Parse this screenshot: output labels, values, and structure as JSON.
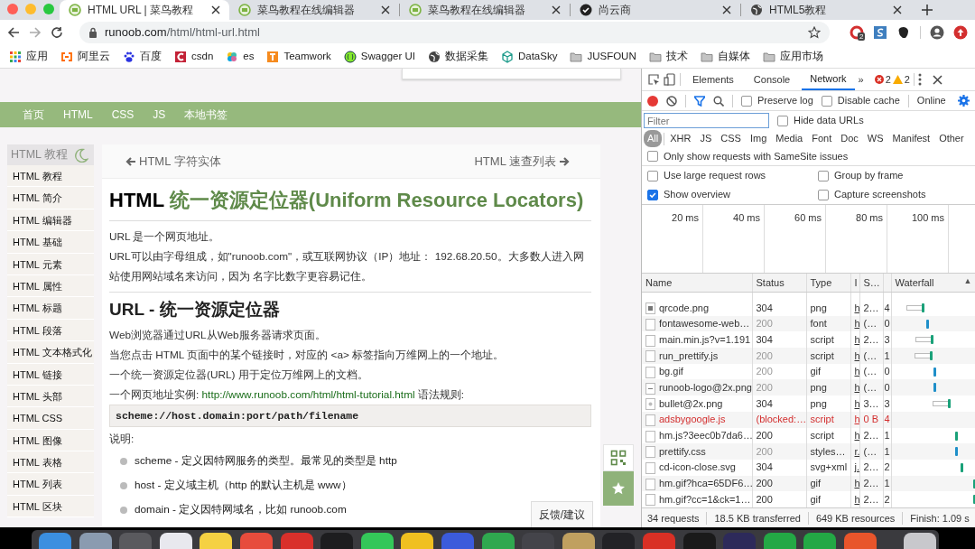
{
  "browser": {
    "tabs": [
      {
        "title": "HTML URL | 菜鸟教程",
        "selected": true
      },
      {
        "title": "菜鸟教程在线编辑器",
        "selected": false
      },
      {
        "title": "菜鸟教程在线编辑器",
        "selected": false
      },
      {
        "title": "尚云商",
        "selected": false
      },
      {
        "title": "HTML5教程",
        "selected": false
      }
    ],
    "address": {
      "host": "runoob.com",
      "path": "/html/html-url.html"
    },
    "extension_badge": "2",
    "bookmarks": [
      "应用",
      "阿里云",
      "百度",
      "csdn",
      "es",
      "Teamwork",
      "Swagger UI",
      "数据采集",
      "DataSky",
      "JUSFOUN",
      "技术",
      "自媒体",
      "应用市场"
    ]
  },
  "page": {
    "nav": [
      "首页",
      "HTML",
      "CSS",
      "JS",
      "本地书签"
    ],
    "sidebar": {
      "title": "HTML 教程",
      "items": [
        "HTML 教程",
        "HTML 简介",
        "HTML 编辑器",
        "HTML 基础",
        "HTML 元素",
        "HTML 属性",
        "HTML 标题",
        "HTML 段落",
        "HTML 文本格式化",
        "HTML 链接",
        "HTML 头部",
        "HTML CSS",
        "HTML 图像",
        "HTML 表格",
        "HTML 列表",
        "HTML 区块"
      ]
    },
    "pager": {
      "prev": "HTML 字符实体",
      "next": "HTML 速查列表"
    },
    "article": [
      {
        "kind": "h1",
        "lead": "HTML",
        "text": "统一资源定位器(Uniform Resource Locators)"
      },
      {
        "kind": "rule"
      },
      {
        "kind": "p",
        "text": "URL 是一个网页地址。"
      },
      {
        "kind": "p",
        "text": "URL可以由字母组成，如\"runoob.com\"，或互联网协议（IP）地址： 192.68.20.50。大多数人进入网站使用网站域名来访问，因为 名字比数字更容易记住。"
      },
      {
        "kind": "rule"
      },
      {
        "kind": "h2",
        "text": "URL - 统一资源定位器"
      },
      {
        "kind": "p",
        "text": "Web浏览器通过URL从Web服务器请求页面。"
      },
      {
        "kind": "p",
        "text": "当您点击 HTML 页面中的某个链接时，对应的 <a> 标签指向万维网上的一个地址。"
      },
      {
        "kind": "p",
        "text": "一个统一资源定位器(URL) 用于定位万维网上的文档。"
      },
      {
        "kind": "link_p",
        "before": "一个网页地址实例: ",
        "link": "http://www.runoob.com/html/html-tutorial.html",
        "after": " 语法规则:"
      },
      {
        "kind": "code",
        "text": "scheme://host.domain:port/path/filename"
      },
      {
        "kind": "p",
        "text": "说明:"
      },
      {
        "kind": "bullet",
        "text": "scheme - 定义因特网服务的类型。最常见的类型是 http"
      },
      {
        "kind": "bullet",
        "text": "host - 定义域主机（http 的默认主机是 www）"
      },
      {
        "kind": "bullet",
        "text": "domain - 定义因特网域名，比如 runoob.com"
      }
    ],
    "feedback": "反馈/建议"
  },
  "devtools": {
    "tabs": [
      {
        "label": "Elements",
        "selected": false
      },
      {
        "label": "Console",
        "selected": false
      },
      {
        "label": "Network",
        "selected": true
      }
    ],
    "more": "»",
    "errors": "2",
    "warnings": "2",
    "toolbar_checks": [
      {
        "label": "Preserve log",
        "checked": false
      },
      {
        "label": "Disable cache",
        "checked": false
      }
    ],
    "throttle": "Online",
    "filter": {
      "placeholder": "Filter"
    },
    "hide_data": {
      "label": "Hide data URLs",
      "checked": false
    },
    "types": [
      {
        "label": "All",
        "selected": true
      },
      {
        "label": "XHR",
        "selected": false
      },
      {
        "label": "JS",
        "selected": false
      },
      {
        "label": "CSS",
        "selected": false
      },
      {
        "label": "Img",
        "selected": false
      },
      {
        "label": "Media",
        "selected": false
      },
      {
        "label": "Font",
        "selected": false
      },
      {
        "label": "Doc",
        "selected": false
      },
      {
        "label": "WS",
        "selected": false
      },
      {
        "label": "Manifest",
        "selected": false
      },
      {
        "label": "Other",
        "selected": false
      }
    ],
    "samesite": {
      "label": "Only show requests with SameSite issues",
      "checked": false
    },
    "options": [
      {
        "label": "Use large request rows",
        "checked": false
      },
      {
        "label": "Group by frame",
        "checked": false
      },
      {
        "label": "Show overview",
        "checked": true
      },
      {
        "label": "Capture screenshots",
        "checked": false
      }
    ],
    "overview_ticks": [
      "20 ms",
      "40 ms",
      "60 ms",
      "80 ms",
      "100 ms"
    ],
    "columns": [
      "Name",
      "Status",
      "Type",
      "I",
      "S…",
      "Waterfall"
    ],
    "sort_glyph": "▲",
    "rows": [
      {
        "name": "qrcode.png",
        "status": "304",
        "type": "png",
        "initiator": "h",
        "size": "2…",
        "time": "4",
        "cached": false,
        "failed": false,
        "level": 0.37,
        "queued": true,
        "color": "#1aa179"
      },
      {
        "name": "fontawesome-web…",
        "status": "200",
        "type": "font",
        "initiator": "h",
        "size": "(…",
        "time": "0",
        "cached": true,
        "failed": false,
        "level": 0.42,
        "queued": false,
        "color": "#1f8fc9"
      },
      {
        "name": "main.min.js?v=1.191",
        "status": "304",
        "type": "script",
        "initiator": "h",
        "size": "2…",
        "time": "3",
        "cached": false,
        "failed": false,
        "level": 0.48,
        "queued": true,
        "color": "#1aa179"
      },
      {
        "name": "run_prettify.js",
        "status": "200",
        "type": "script",
        "initiator": "h",
        "size": "(…",
        "time": "1",
        "cached": true,
        "failed": false,
        "level": 0.47,
        "queued": true,
        "color": "#1aa179"
      },
      {
        "name": "bg.gif",
        "status": "200",
        "type": "gif",
        "initiator": "h",
        "size": "(…",
        "time": "0",
        "cached": true,
        "failed": false,
        "level": 0.51,
        "queued": false,
        "color": "#1f8fc9"
      },
      {
        "name": "runoob-logo@2x.png",
        "status": "200",
        "type": "png",
        "initiator": "h",
        "size": "(…",
        "time": "0",
        "cached": true,
        "failed": false,
        "level": 0.51,
        "queued": false,
        "color": "#1f8fc9"
      },
      {
        "name": "bullet@2x.png",
        "status": "304",
        "type": "png",
        "initiator": "h",
        "size": "3…",
        "time": "3",
        "cached": false,
        "failed": false,
        "level": 0.68,
        "queued": true,
        "color": "#1aa179"
      },
      {
        "name": "adsbygoogle.js",
        "status": "(blocked:…",
        "type": "script",
        "initiator": "h",
        "size": "0 B",
        "time": "4",
        "failed": true
      },
      {
        "name": "hm.js?3eec0b7da6…",
        "status": "200",
        "type": "script",
        "initiator": "h",
        "size": "2…",
        "time": "1",
        "cached": false,
        "failed": false,
        "level": 0.77,
        "queued": false,
        "color": "#1aa179"
      },
      {
        "name": "prettify.css",
        "status": "200",
        "type": "styles…",
        "initiator": "r.",
        "size": "(…",
        "time": "1",
        "cached": true,
        "failed": false,
        "level": 0.77,
        "queued": false,
        "color": "#1f8fc9"
      },
      {
        "name": "cd-icon-close.svg",
        "status": "304",
        "type": "svg+xml",
        "initiator": "j.",
        "size": "2…",
        "time": "2",
        "cached": false,
        "failed": false,
        "level": 0.83,
        "queued": false,
        "color": "#1aa179"
      },
      {
        "name": "hm.gif?hca=65DF6…",
        "status": "200",
        "type": "gif",
        "initiator": "h",
        "size": "2…",
        "time": "1",
        "cached": false,
        "failed": false,
        "level": 0.98,
        "queued": false,
        "color": "#1aa179"
      },
      {
        "name": "hm.gif?cc=1&ck=1…",
        "status": "200",
        "type": "gif",
        "initiator": "h",
        "size": "2…",
        "time": "2",
        "cached": false,
        "failed": false,
        "level": 0.98,
        "queued": false,
        "color": "#1aa179"
      }
    ],
    "summary": [
      "34 requests",
      "18.5 KB transferred",
      "649 KB resources",
      "Finish: 1.09 s"
    ]
  },
  "dock": [
    {
      "color": "#3b8fe0"
    },
    {
      "color": "#8a9bb0"
    },
    {
      "color": "#5a5a5e"
    },
    {
      "color": "#e8e8ee"
    },
    {
      "color": "#f5d142"
    },
    {
      "color": "#e74c3c"
    },
    {
      "color": "#d9302b"
    },
    {
      "color": "#1d1d1f"
    },
    {
      "color": "#34c759"
    },
    {
      "color": "#f0c020"
    },
    {
      "color": "#3b5bdb"
    },
    {
      "color": "#2fa84f"
    },
    {
      "color": "#44444a"
    },
    {
      "color": "#c0a060"
    },
    {
      "color": "#222226"
    },
    {
      "color": "#d93025"
    },
    {
      "color": "#1a1a1a"
    },
    {
      "color": "#2d2a5a"
    },
    {
      "color": "#23a845"
    },
    {
      "color": "#23a845"
    },
    {
      "color": "#e8552b"
    },
    {
      "color": "#c8c8cc"
    }
  ]
}
